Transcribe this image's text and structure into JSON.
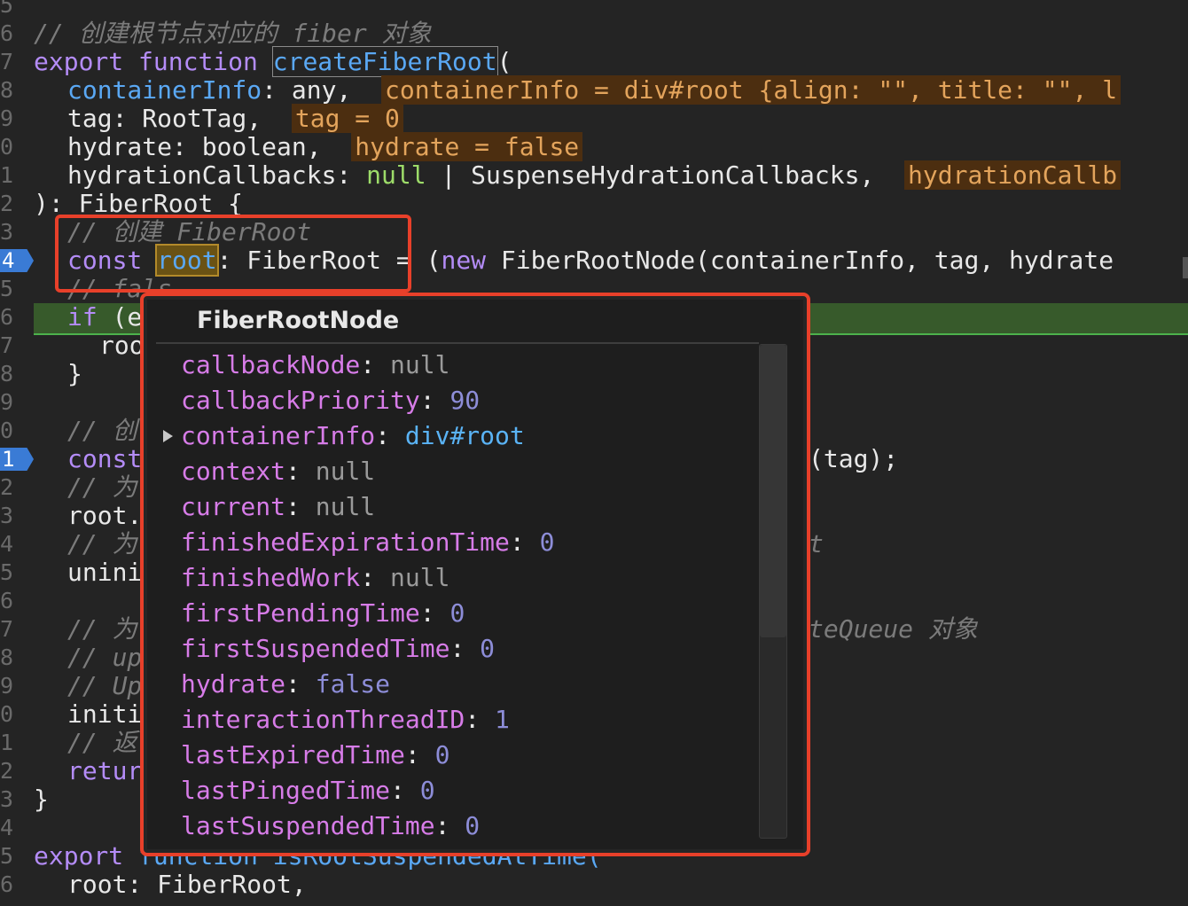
{
  "gutter": [
    "5",
    "6",
    "7",
    "8",
    "9",
    "0",
    "1",
    "2",
    "3",
    "4",
    "5",
    "6",
    "7",
    "8",
    "9",
    "0",
    "1",
    "2",
    "3",
    "4",
    "5",
    "6",
    "7",
    "8",
    "9",
    "0",
    "1",
    "2",
    "3",
    "4",
    "5",
    "6"
  ],
  "code": {
    "l6_comment": "// 创建根节点对应的 fiber 对象",
    "l7_export": "export",
    "l7_function": "function",
    "l7_name": "createFiberRoot",
    "l7_paren": "(",
    "l8_param": "containerInfo: any,",
    "l8_hint": "containerInfo = div#root {align: \"\", title: \"\", l",
    "l9_param": "tag: RootTag,",
    "l9_hint": "tag = 0",
    "l10_param": "hydrate: boolean,",
    "l10_hint": "hydrate = false",
    "l11_param_a": "hydrationCallbacks: ",
    "l11_null": "null",
    "l11_param_b": " | SuspenseHydrationCallbacks,",
    "l11_hint": "hydrationCallb",
    "l12": "): FiberRoot {",
    "l13_comment": "// 创建 FiberRoot",
    "l14_const": "const",
    "l14_root": "root",
    "l14_type": ": FiberRoot",
    "l14_eq": " = (",
    "l14_new": "new",
    "l14_rest": " FiberRootNode(containerInfo, tag, hydrate",
    "l15_comment": "// fals",
    "l16_if": "if",
    "l16_rest": " (e",
    "l17": "roo",
    "l18": "}",
    "l20_comment": "// 创",
    "l21_const": "const",
    "l21_tail": "(tag);",
    "l22_comment": "// 为",
    "l23": "root.",
    "l24_comment": "// 为",
    "l24_tail": "t",
    "l25": "unini",
    "l27_comment": "// 为",
    "l27_tail": "teQueue 对象",
    "l28_comment": "// up",
    "l29_comment": "// Up",
    "l30": "initi",
    "l31_comment": "// 返",
    "l32_return": "retur",
    "l33": "}",
    "l35_export": "export",
    "l35_rest": " function isRootSuspendedAtTime(",
    "l36": "root: FiberRoot,"
  },
  "breakpoints": [
    "4",
    "1"
  ],
  "popup": {
    "title": "FiberRootNode",
    "props": [
      {
        "key": "callbackNode",
        "value": "null",
        "kind": "null"
      },
      {
        "key": "callbackPriority",
        "value": "90",
        "kind": "num"
      },
      {
        "key": "containerInfo",
        "value": "div#root",
        "kind": "str",
        "expandable": true
      },
      {
        "key": "context",
        "value": "null",
        "kind": "null"
      },
      {
        "key": "current",
        "value": "null",
        "kind": "null"
      },
      {
        "key": "finishedExpirationTime",
        "value": "0",
        "kind": "num"
      },
      {
        "key": "finishedWork",
        "value": "null",
        "kind": "null"
      },
      {
        "key": "firstPendingTime",
        "value": "0",
        "kind": "num"
      },
      {
        "key": "firstSuspendedTime",
        "value": "0",
        "kind": "num"
      },
      {
        "key": "hydrate",
        "value": "false",
        "kind": "num"
      },
      {
        "key": "interactionThreadID",
        "value": "1",
        "kind": "num"
      },
      {
        "key": "lastExpiredTime",
        "value": "0",
        "kind": "num"
      },
      {
        "key": "lastPingedTime",
        "value": "0",
        "kind": "num"
      },
      {
        "key": "lastSuspendedTime",
        "value": "0",
        "kind": "num"
      }
    ]
  },
  "colors": {
    "accent_red": "#e8402a",
    "keyword": "#b48cf7",
    "function": "#5aa8f4",
    "property": "#d77ce8",
    "number": "#8d8dd8"
  }
}
